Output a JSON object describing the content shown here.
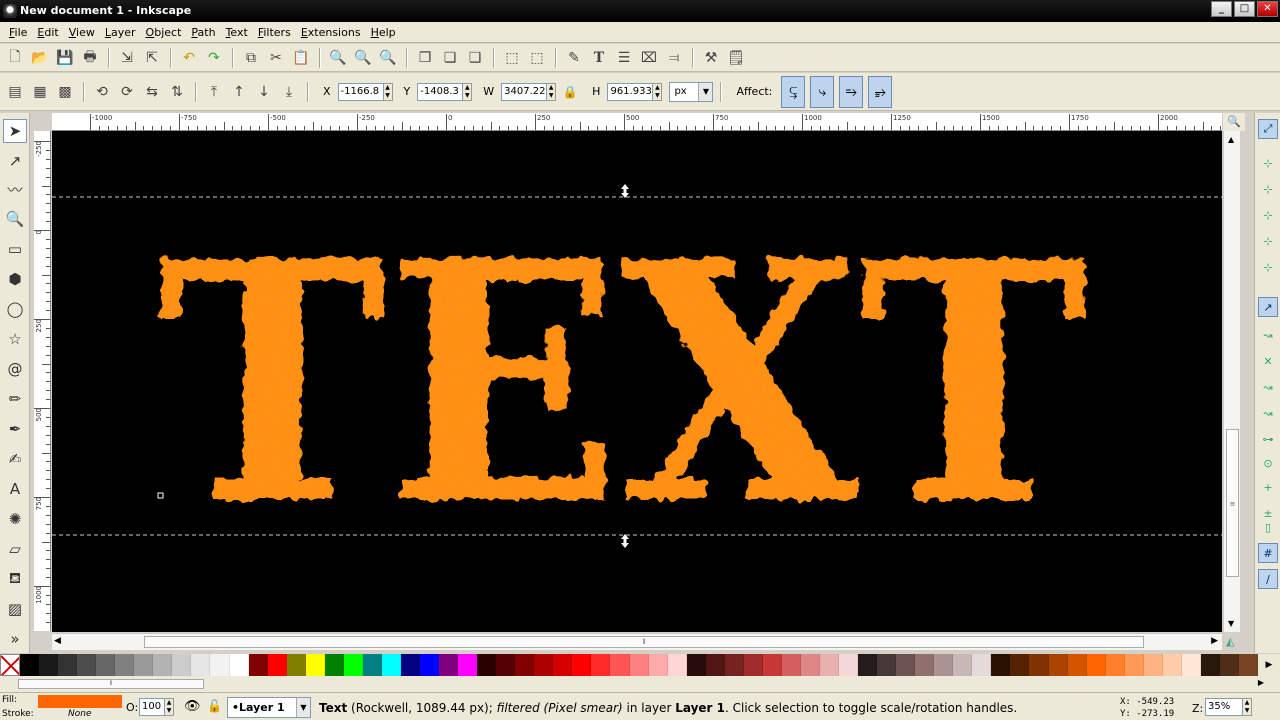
{
  "window": {
    "title": "New document 1 - Inkscape",
    "min": "_",
    "max": "□",
    "close": "✕"
  },
  "menu": [
    "File",
    "Edit",
    "View",
    "Layer",
    "Object",
    "Path",
    "Text",
    "Filters",
    "Extensions",
    "Help"
  ],
  "commands": [
    "new-icon",
    "open-icon",
    "save-icon",
    "print-icon",
    "import-icon",
    "export-icon",
    "undo-icon",
    "redo-icon",
    "copy-icon",
    "cut-icon",
    "paste-icon",
    "zoom-selection-icon",
    "zoom-drawing-icon",
    "zoom-page-icon",
    "duplicate-icon",
    "clone-icon",
    "unlink-clone-icon",
    "group-icon",
    "ungroup-icon",
    "fill-stroke-icon",
    "text-font-icon",
    "layers-icon",
    "xml-editor-icon",
    "align-icon",
    "preferences-icon",
    "document-properties-icon"
  ],
  "selector": {
    "x_label": "X",
    "x_value": "-1166.8",
    "y_label": "Y",
    "y_value": "-1408.3",
    "w_label": "W",
    "w_value": "3407.22",
    "h_label": "H",
    "h_value": "961.933",
    "unit": "px",
    "affect_label": "Affect:"
  },
  "rulers": {
    "h_labels": [
      "-1000",
      "-750",
      "-500",
      "-250",
      "0",
      "250",
      "500",
      "750",
      "1000",
      "1250",
      "1500",
      "1750",
      "2000"
    ],
    "v_labels": [
      "-250",
      "0",
      "250",
      "500",
      "750",
      "1000"
    ]
  },
  "canvas": {
    "text": "TEXT",
    "text_color": "#ff8a1a",
    "text_shadow": "#ff5a00",
    "background": "#000000"
  },
  "palette": [
    "#000000",
    "#1a1a1a",
    "#333333",
    "#4d4d4d",
    "#666666",
    "#808080",
    "#999999",
    "#b3b3b3",
    "#cccccc",
    "#e6e6e6",
    "#f2f2f2",
    "#ffffff",
    "#800000",
    "#ff0000",
    "#808000",
    "#ffff00",
    "#008000",
    "#00ff00",
    "#008080",
    "#00ffff",
    "#000080",
    "#0000ff",
    "#800080",
    "#ff00ff",
    "#2b0000",
    "#550000",
    "#800000",
    "#aa0000",
    "#d40000",
    "#ff0000",
    "#ff2a2a",
    "#ff5555",
    "#ff8080",
    "#ffaaaa",
    "#ffd5d5",
    "#280b0b",
    "#501616",
    "#782121",
    "#a02c2c",
    "#c83737",
    "#d35f5f",
    "#de8787",
    "#e9afaf",
    "#f4d7d7",
    "#241c1c",
    "#483737",
    "#6c5353",
    "#916f6f",
    "#ac9393",
    "#c8b7b7",
    "#e3dbdb",
    "#2b1100",
    "#552200",
    "#803300",
    "#aa4400",
    "#d45500",
    "#ff6600",
    "#ff7f2a",
    "#ff9955",
    "#ffb380",
    "#ffccaa",
    "#ffe6d5",
    "#28170b",
    "#502d16",
    "#784421"
  ],
  "status": {
    "fill_label": "Fill:",
    "stroke_label": "Stroke:",
    "fill_color": "#ff6600",
    "stroke_value": "None",
    "opacity_label": "O:",
    "opacity_value": "100",
    "layer": "•Layer 1",
    "message_bold1": "Text",
    "message_part1": " (Rockwell, 1089.44 px); ",
    "message_italic": "filtered (Pixel smear)",
    "message_part2": " in layer ",
    "message_bold2": "Layer 1",
    "message_part3": ". Click selection to toggle scale/rotation handles.",
    "cursor_x": "X: -549.23",
    "cursor_y": "Y: -273.19",
    "zoom_label": "Z:",
    "zoom_value": "35%"
  }
}
